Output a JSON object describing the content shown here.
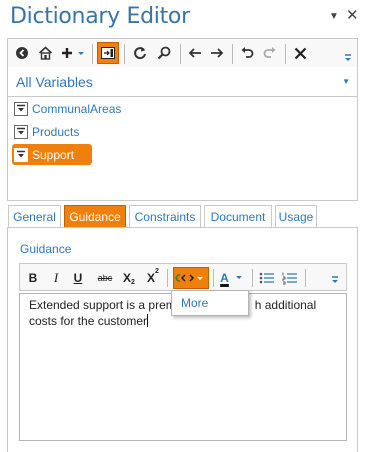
{
  "window": {
    "title": "Dictionary Editor",
    "pin_icon": "pin-dropdown-icon",
    "close_icon": "close-icon"
  },
  "toolbar": {
    "buttons": [
      "navigate-icon",
      "home-icon",
      "add-icon",
      "layout-icon",
      "refresh-icon",
      "find-icon",
      "back-icon",
      "forward-icon",
      "undo-icon",
      "redo-icon",
      "delete-icon",
      "overflow-icon"
    ]
  },
  "variables_selector": {
    "value": "All Variables"
  },
  "tree": {
    "items": [
      {
        "label": "CommunalAreas",
        "selected": false
      },
      {
        "label": "Products",
        "selected": false
      },
      {
        "label": "Support",
        "selected": true
      }
    ]
  },
  "tabs": [
    {
      "label": "General",
      "active": false
    },
    {
      "label": "Guidance",
      "active": true
    },
    {
      "label": "Constraints",
      "active": false
    },
    {
      "label": "Document",
      "active": false
    },
    {
      "label": "Usage",
      "active": false
    }
  ],
  "guidance": {
    "section_label": "Guidance",
    "format": {
      "bold": "B",
      "italic": "I",
      "underline": "U",
      "strike": "abc",
      "subscript": "X",
      "subscript_mark": "2",
      "superscript": "X",
      "superscript_mark": "2",
      "font_color": "A"
    },
    "editor_text": "Extended support is a premium feature with additional costs for the customer",
    "editor_text_line1_before": "Extended support is a prem",
    "editor_text_line1_after": "h additional",
    "editor_text_line2": "costs for the customer"
  },
  "code_dropdown": {
    "items": [
      "More"
    ]
  },
  "colors": {
    "accent": "#f07f0c",
    "link": "#2f78b8",
    "title": "#3874a8"
  }
}
